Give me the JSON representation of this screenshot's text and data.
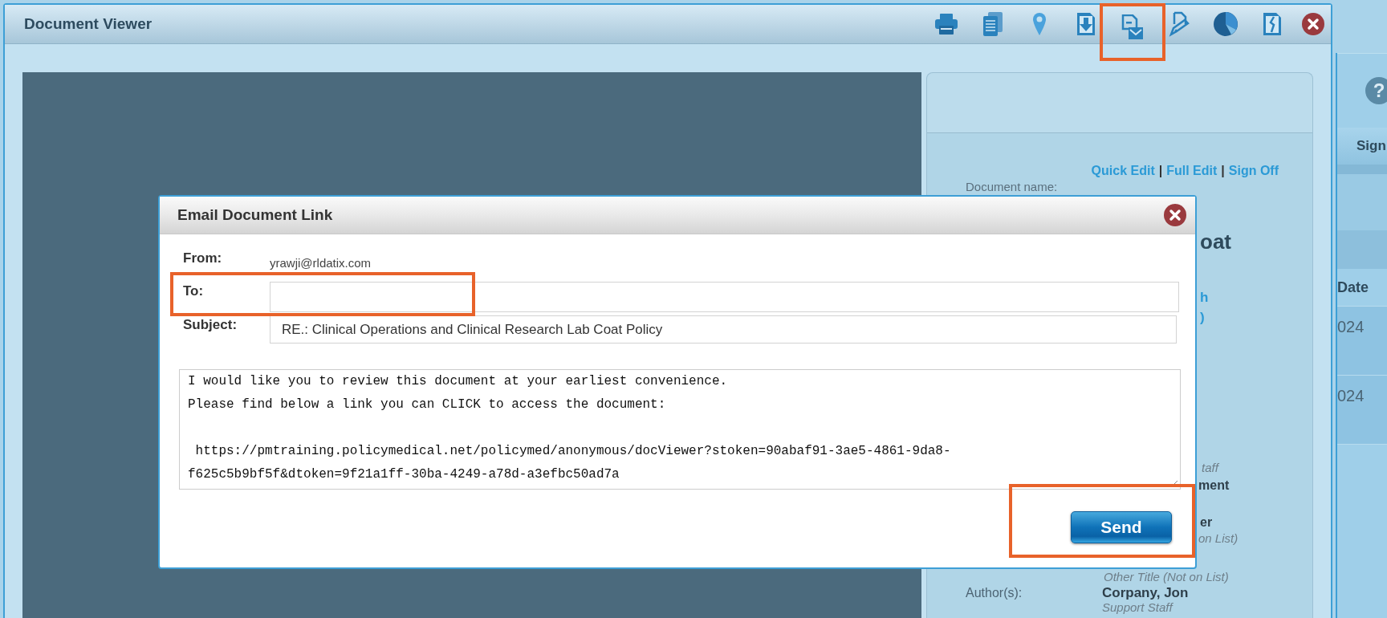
{
  "window": {
    "title": "Document Viewer"
  },
  "toolbar": [
    {
      "kind": "printer",
      "highlighted": false
    },
    {
      "kind": "pages",
      "highlighted": false
    },
    {
      "kind": "pin",
      "highlighted": false
    },
    {
      "kind": "download",
      "highlighted": false
    },
    {
      "kind": "mail",
      "highlighted": true
    },
    {
      "kind": "edit",
      "highlighted": false
    },
    {
      "kind": "pie",
      "highlighted": false
    },
    {
      "kind": "split",
      "highlighted": false
    },
    {
      "kind": "close",
      "highlighted": false
    }
  ],
  "document_panel": {
    "actions": [
      {
        "kind": "link",
        "text": "Quick Edit"
      },
      {
        "kind": "separator",
        "text": "|"
      },
      {
        "kind": "link",
        "text": "Full Edit"
      },
      {
        "kind": "separator",
        "text": "|"
      },
      {
        "kind": "link",
        "text": "Sign Off"
      }
    ],
    "name_label": "Document name:",
    "fragments": [
      {
        "kind": "title",
        "text": "oat"
      },
      {
        "kind": "link",
        "text": "h"
      },
      {
        "kind": "link",
        "text": ")"
      },
      {
        "kind": "role",
        "text": "taff"
      },
      {
        "kind": "name",
        "text": "ment"
      },
      {
        "kind": "name",
        "text": "er"
      },
      {
        "kind": "role",
        "text": "on List)"
      },
      {
        "kind": "role",
        "text": "Other Title (Not on List)"
      }
    ],
    "author": {
      "label": "Author(s):",
      "name": "Corpany, Jon",
      "role": "Support Staff"
    }
  },
  "side_strip": {
    "help": "?",
    "header": "Sign",
    "column": "Date",
    "cells": [
      "024",
      "024"
    ]
  },
  "dialog": {
    "title": "Email Document Link",
    "from": {
      "label": "From:",
      "value": "yrawji@rldatix.com"
    },
    "to": {
      "label": "To:",
      "highlighted": true
    },
    "subject": {
      "label": "Subject:",
      "value": "RE.: Clinical Operations and Clinical Research Lab Coat Policy",
      "highlighted": false
    },
    "message": "I would like you to review this document at your earliest convenience.\nPlease find below a link you can CLICK to access the document:\n\n https://pmtraining.policymedical.net/policymed/anonymous/docViewer?stoken=90abaf91-3ae5-4861-9da8-f625c5b9bf5f&dtoken=9f21a1ff-30ba-4249-a78d-a3efbc50ad7a",
    "send": {
      "label": "Send",
      "highlighted": true
    }
  }
}
